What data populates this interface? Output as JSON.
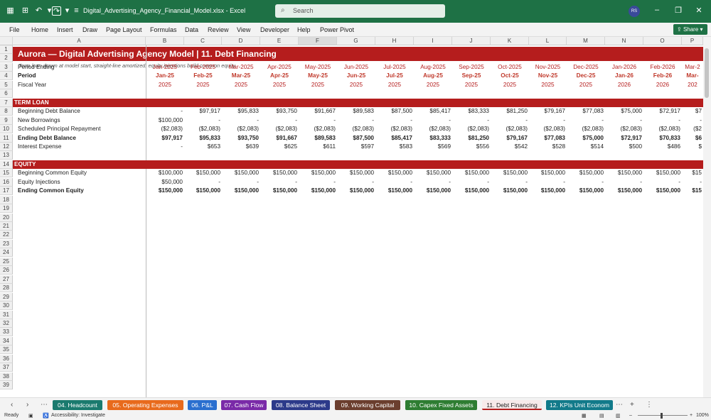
{
  "window": {
    "filename": "Digital_Advertising_Agency_Financial_Model.xlsx  -  Excel",
    "search_placeholder": "Search",
    "user_initials": "RS"
  },
  "ribbon": {
    "menus": [
      "File",
      "Home",
      "Insert",
      "Draw",
      "Page Layout",
      "Formulas",
      "Data",
      "Review",
      "View",
      "Developer",
      "Help",
      "Power Pivot"
    ],
    "share_label": "Share"
  },
  "columns": [
    "A",
    "B",
    "C",
    "D",
    "E",
    "F",
    "G",
    "H",
    "I",
    "J",
    "K",
    "L",
    "M",
    "N",
    "O",
    "P"
  ],
  "row_numbers": [
    "1",
    "2",
    "3",
    "4",
    "5",
    "6",
    "7",
    "8",
    "9",
    "10",
    "11",
    "12",
    "13",
    "14",
    "15",
    "16",
    "17",
    "18",
    "19",
    "20",
    "21",
    "22",
    "23",
    "24",
    "25",
    "26",
    "27",
    "28",
    "29",
    "30",
    "31",
    "32",
    "33",
    "34",
    "35",
    "36",
    "37",
    "38",
    "39"
  ],
  "sheet": {
    "title": "Aurora — Digital Advertising Agency Model  |  11. Debt Financing",
    "subtitle": "Term loan drawn at model start, straight-line amortized; equity injections build common equity.",
    "header_rows": [
      {
        "label": "Period Ending",
        "bold": false,
        "values": [
          "Jan-2025",
          "Feb-2025",
          "Mar-2025",
          "Apr-2025",
          "May-2025",
          "Jun-2025",
          "Jul-2025",
          "Aug-2025",
          "Sep-2025",
          "Oct-2025",
          "Nov-2025",
          "Dec-2025",
          "Jan-2026",
          "Feb-2026",
          "Mar-2"
        ]
      },
      {
        "label": "Period",
        "bold": true,
        "values": [
          "Jan-25",
          "Feb-25",
          "Mar-25",
          "Apr-25",
          "May-25",
          "Jun-25",
          "Jul-25",
          "Aug-25",
          "Sep-25",
          "Oct-25",
          "Nov-25",
          "Dec-25",
          "Jan-26",
          "Feb-26",
          "Mar-"
        ]
      },
      {
        "label": "Fiscal Year",
        "bold": false,
        "values": [
          "2025",
          "2025",
          "2025",
          "2025",
          "2025",
          "2025",
          "2025",
          "2025",
          "2025",
          "2025",
          "2025",
          "2025",
          "2026",
          "2026",
          "202"
        ]
      }
    ],
    "term_loan": {
      "header": "TERM LOAN",
      "rows": [
        {
          "label": "Beginning Debt Balance",
          "bold": false,
          "values": [
            "-",
            "$97,917",
            "$95,833",
            "$93,750",
            "$91,667",
            "$89,583",
            "$87,500",
            "$85,417",
            "$83,333",
            "$81,250",
            "$79,167",
            "$77,083",
            "$75,000",
            "$72,917",
            "$7"
          ]
        },
        {
          "label": "New Borrowings",
          "bold": false,
          "values": [
            "$100,000",
            "-",
            "-",
            "-",
            "-",
            "-",
            "-",
            "-",
            "-",
            "-",
            "-",
            "-",
            "-",
            "-",
            "-"
          ]
        },
        {
          "label": "Scheduled Principal Repayment",
          "bold": false,
          "values": [
            "($2,083)",
            "($2,083)",
            "($2,083)",
            "($2,083)",
            "($2,083)",
            "($2,083)",
            "($2,083)",
            "($2,083)",
            "($2,083)",
            "($2,083)",
            "($2,083)",
            "($2,083)",
            "($2,083)",
            "($2,083)",
            "($2"
          ]
        },
        {
          "label": "Ending Debt Balance",
          "bold": true,
          "values": [
            "$97,917",
            "$95,833",
            "$93,750",
            "$91,667",
            "$89,583",
            "$87,500",
            "$85,417",
            "$83,333",
            "$81,250",
            "$79,167",
            "$77,083",
            "$75,000",
            "$72,917",
            "$70,833",
            "$6"
          ]
        },
        {
          "label": "Interest Expense",
          "bold": false,
          "values": [
            "-",
            "$653",
            "$639",
            "$625",
            "$611",
            "$597",
            "$583",
            "$569",
            "$556",
            "$542",
            "$528",
            "$514",
            "$500",
            "$486",
            "$"
          ]
        }
      ]
    },
    "equity": {
      "header": "EQUITY",
      "rows": [
        {
          "label": "Beginning Common Equity",
          "bold": false,
          "values": [
            "$100,000",
            "$150,000",
            "$150,000",
            "$150,000",
            "$150,000",
            "$150,000",
            "$150,000",
            "$150,000",
            "$150,000",
            "$150,000",
            "$150,000",
            "$150,000",
            "$150,000",
            "$150,000",
            "$15"
          ]
        },
        {
          "label": "Equity Injections",
          "bold": false,
          "values": [
            "$50,000",
            "-",
            "-",
            "-",
            "-",
            "-",
            "-",
            "-",
            "-",
            "-",
            "-",
            "-",
            "-",
            "-",
            "-"
          ]
        },
        {
          "label": "Ending Common Equity",
          "bold": true,
          "values": [
            "$150,000",
            "$150,000",
            "$150,000",
            "$150,000",
            "$150,000",
            "$150,000",
            "$150,000",
            "$150,000",
            "$150,000",
            "$150,000",
            "$150,000",
            "$150,000",
            "$150,000",
            "$150,000",
            "$15"
          ]
        }
      ]
    }
  },
  "tabs": [
    {
      "label": "04. Headcount",
      "color": "#1a7a6e",
      "active": false
    },
    {
      "label": "05. Operating Expenses",
      "color": "#e86a1c",
      "active": false
    },
    {
      "label": "06. P&L",
      "color": "#2a6fcf",
      "active": false
    },
    {
      "label": "07. Cash Flow",
      "color": "#7a2aa8",
      "active": false
    },
    {
      "label": "08. Balance Sheet",
      "color": "#2c3a8a",
      "active": false
    },
    {
      "label": "09. Working Capital",
      "color": "#6b3e2e",
      "active": false
    },
    {
      "label": "10. Capex Fixed Assets",
      "color": "#2e7d32",
      "active": false
    },
    {
      "label": "11. Debt Financing",
      "color": "#b51d1d",
      "active": true
    },
    {
      "label": "12. KPIs Unit Econom",
      "color": "#127a8a",
      "active": false
    }
  ],
  "status": {
    "ready": "Ready",
    "accessibility": "Accessibility: Investigate",
    "zoom": "100%"
  }
}
